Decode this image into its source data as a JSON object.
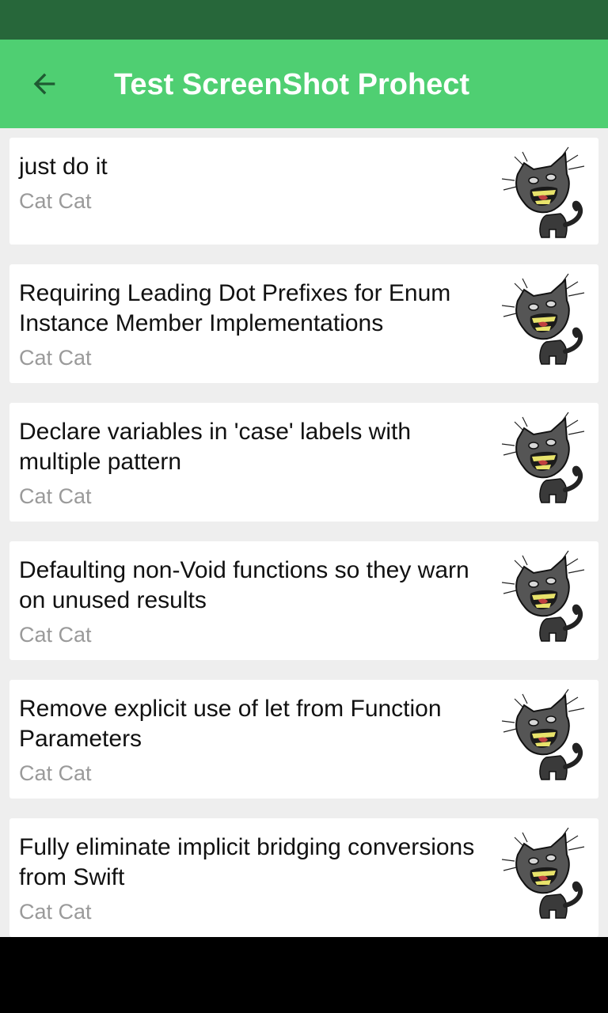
{
  "app_bar": {
    "title": "Test ScreenShot Prohect",
    "back_icon": "arrow-left-icon",
    "background": "#4fcf72"
  },
  "status_bar": {
    "background": "#27673a"
  },
  "list": {
    "items": [
      {
        "title": "just do it",
        "author": "Cat Cat",
        "thumbnail_icon": "cat-icon"
      },
      {
        "title": "Requiring Leading Dot Prefixes for Enum Instance Member Implementations",
        "author": "Cat Cat",
        "thumbnail_icon": "cat-icon"
      },
      {
        "title": "Declare variables in 'case' labels with multiple pattern",
        "author": "Cat Cat",
        "thumbnail_icon": "cat-icon"
      },
      {
        "title": "Defaulting non-Void functions so they warn on unused results",
        "author": "Cat Cat",
        "thumbnail_icon": "cat-icon"
      },
      {
        "title": "Remove explicit use of let from Function Parameters",
        "author": "Cat Cat",
        "thumbnail_icon": "cat-icon"
      },
      {
        "title": "Fully eliminate implicit bridging conversions from Swift",
        "author": "Cat Cat",
        "thumbnail_icon": "cat-icon"
      }
    ]
  }
}
